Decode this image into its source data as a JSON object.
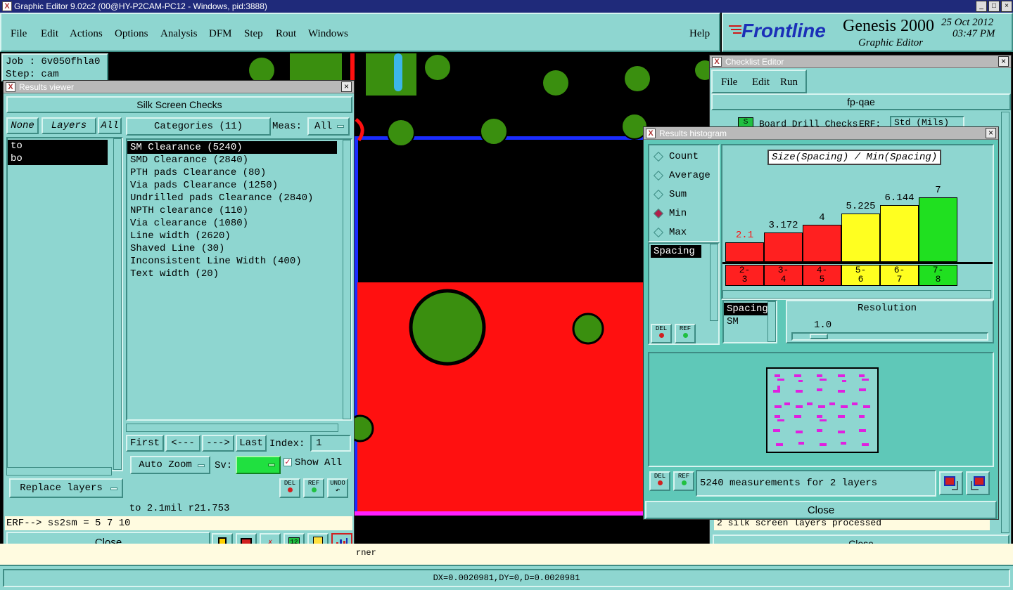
{
  "app": {
    "title": "Graphic Editor 9.02c2 (00@HY-P2CAM-PC12 - Windows, pid:3888)",
    "menu": [
      "File",
      "Edit",
      "Actions",
      "Options",
      "Analysis",
      "DFM",
      "Step",
      "Rout",
      "Windows"
    ],
    "help": "Help",
    "brand": "Frontline",
    "product": "Genesis 2000",
    "subtitle": "Graphic Editor",
    "date": "25 Oct 2012",
    "time": "03:47 PM",
    "job": "Job : 6v050fhla0",
    "step": "Step: cam"
  },
  "results_viewer": {
    "title": "Results viewer",
    "heading": "Silk Screen Checks",
    "none_btn": "None",
    "layers_btn": "Layers",
    "all_btn": "All",
    "layers": [
      "to",
      "bo"
    ],
    "categories_btn": "Categories (11)",
    "meas_label": "Meas:",
    "meas_value": "All",
    "categories": [
      "SM Clearance (5240)",
      "SMD Clearance (2840)",
      "PTH pads Clearance (80)",
      "Via pads Clearance (1250)",
      "Undrilled pads Clearance (2840)",
      "NPTH clearance (110)",
      "Via clearance (1080)",
      "Line width (2620)",
      "Shaved Line (30)",
      "Inconsistent Line Width (400)",
      "Text width (20)"
    ],
    "first_btn": "First",
    "prev_btn": "<---",
    "next_btn": "--->",
    "last_btn": "Last",
    "index_label": "Index:",
    "index_value": "1",
    "auto_zoom": "Auto Zoom",
    "sv_label": "Sv:",
    "show_all": "Show All",
    "replace_layers": "Replace layers",
    "del": "DEL",
    "ref": "REF",
    "undo": "UNDO",
    "status": "to 2.1mil  r21.753",
    "erf": "ERF--> ss2sm = 5 7 10",
    "close": "Close"
  },
  "checklist_editor": {
    "title": "Checklist Editor",
    "menu": [
      "File",
      "Edit",
      "Run"
    ],
    "name": "fp-qae",
    "row_text": "Board Drill Checks",
    "erf": "ERF:",
    "units": "Std (Mils)",
    "processed": "2 silk screen layers processed",
    "close": "Close"
  },
  "histogram": {
    "title": "Results histogram",
    "modes": [
      "Count",
      "Average",
      "Sum",
      "Min",
      "Max"
    ],
    "selected_mode": "Min",
    "left_list": [
      "Spacing"
    ],
    "chart_title": "Size(Spacing) / Min(Spacing)",
    "bar_labels": [
      "2-\n3",
      "3-\n4",
      "4-\n5",
      "5-\n6",
      "6-\n7",
      "7-\n8"
    ],
    "bar_value_labels": [
      "2.1",
      "3.172",
      "4",
      "5.225",
      "6.144",
      "7"
    ],
    "bar_colors": [
      "#ff2020",
      "#ff2020",
      "#ff2020",
      "#ffff20",
      "#ffff20",
      "#20e020"
    ],
    "param_list": [
      "Spacing",
      "SM"
    ],
    "resolution_label": "Resolution",
    "resolution_value": "1.0",
    "measurements": "5240 measurements for 2 layers",
    "close": "Close",
    "del": "DEL",
    "ref": "REF"
  },
  "chart_data": {
    "type": "bar",
    "title": "Size(Spacing) / Min(Spacing)",
    "categories": [
      "2-3",
      "3-4",
      "4-5",
      "5-6",
      "6-7",
      "7-8"
    ],
    "values": [
      2.1,
      3.172,
      4,
      5.225,
      6.144,
      7
    ],
    "ylim": [
      0,
      7
    ],
    "colors": [
      "#ff2020",
      "#ff2020",
      "#ff2020",
      "#ffff20",
      "#ffff20",
      "#20e020"
    ],
    "grid": false,
    "legend": "none"
  },
  "statusbar": {
    "text": "DX=0.0020981,DY=0,D=0.0020981",
    "fragment": "rner"
  }
}
